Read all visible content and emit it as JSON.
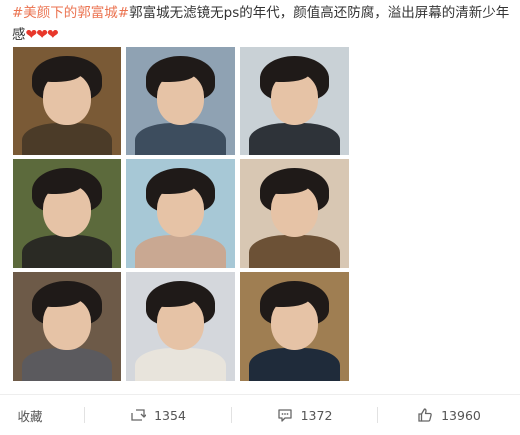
{
  "post": {
    "hashtag": "#美颜下的郭富城#",
    "text": "郭富城无滤镜无ps的年代，颜值高还防腐，溢出屏幕的清新少年感",
    "hearts": "❤❤❤"
  },
  "photos": [
    {
      "bg": "#7a5a36",
      "body": "#4b3b28"
    },
    {
      "bg": "#8fa2b3",
      "body": "#3d4d5e"
    },
    {
      "bg": "#c9d1d6",
      "body": "#2e3339"
    },
    {
      "bg": "#5c6a3c",
      "body": "#2a2a24"
    },
    {
      "bg": "#a7c8d6",
      "body": "#c9a892"
    },
    {
      "bg": "#d8c7b3",
      "body": "#6c5136"
    },
    {
      "bg": "#6d5a48",
      "body": "#5b5a5e"
    },
    {
      "bg": "#d4d7dc",
      "body": "#e8e4dc"
    },
    {
      "bg": "#9f7e52",
      "body": "#1f2b3a"
    }
  ],
  "footer": {
    "favorite_label": "收藏",
    "repost_count": "1354",
    "comment_count": "1372",
    "like_count": "13960"
  }
}
